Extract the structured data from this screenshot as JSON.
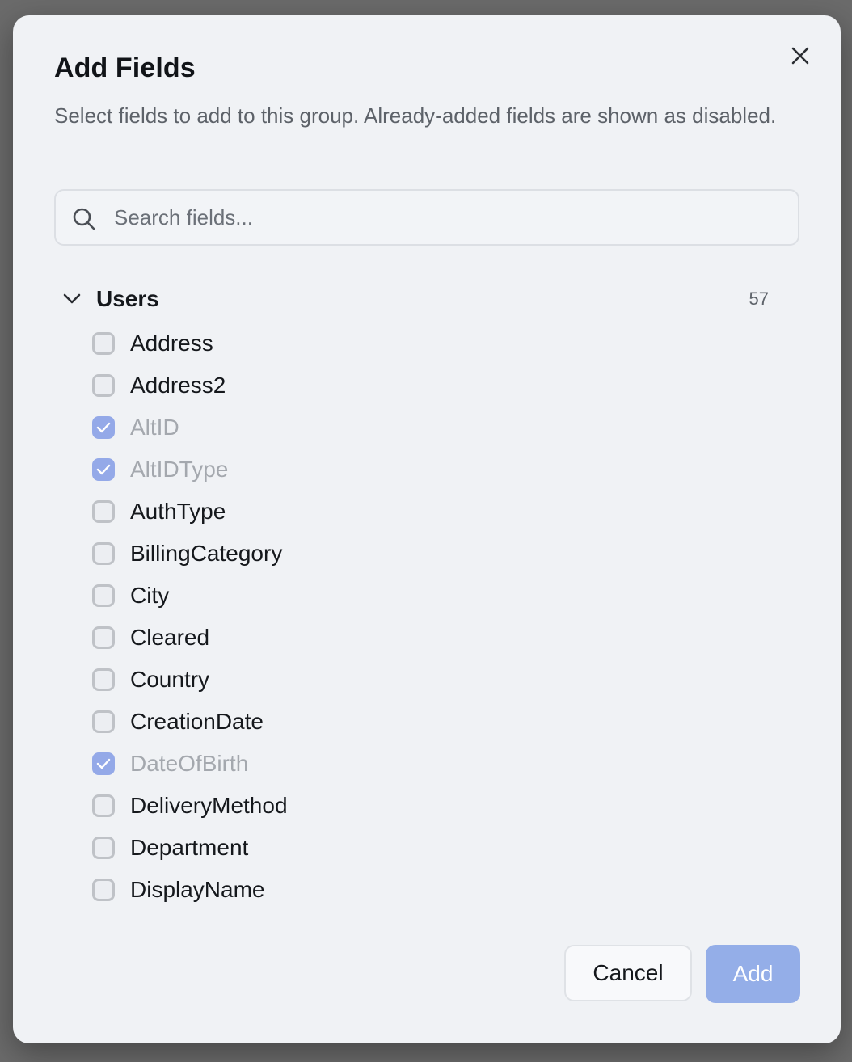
{
  "dialog": {
    "title": "Add Fields",
    "subtitle": "Select fields to add to this group. Already-added fields are shown as disabled.",
    "close_icon": "close-icon"
  },
  "search": {
    "placeholder": "Search fields...",
    "value": "",
    "icon": "search-icon"
  },
  "group": {
    "name": "Users",
    "count": "57",
    "expanded": true,
    "icon": "chevron-down-icon",
    "fields": [
      {
        "label": "Address",
        "checked": false,
        "disabled": false
      },
      {
        "label": "Address2",
        "checked": false,
        "disabled": false
      },
      {
        "label": "AltID",
        "checked": true,
        "disabled": true
      },
      {
        "label": "AltIDType",
        "checked": true,
        "disabled": true
      },
      {
        "label": "AuthType",
        "checked": false,
        "disabled": false
      },
      {
        "label": "BillingCategory",
        "checked": false,
        "disabled": false
      },
      {
        "label": "City",
        "checked": false,
        "disabled": false
      },
      {
        "label": "Cleared",
        "checked": false,
        "disabled": false
      },
      {
        "label": "Country",
        "checked": false,
        "disabled": false
      },
      {
        "label": "CreationDate",
        "checked": false,
        "disabled": false
      },
      {
        "label": "DateOfBirth",
        "checked": true,
        "disabled": true
      },
      {
        "label": "DeliveryMethod",
        "checked": false,
        "disabled": false
      },
      {
        "label": "Department",
        "checked": false,
        "disabled": false
      },
      {
        "label": "DisplayName",
        "checked": false,
        "disabled": false
      }
    ]
  },
  "footer": {
    "cancel_label": "Cancel",
    "add_label": "Add",
    "add_disabled": true
  },
  "colors": {
    "accent": "#94a9e8",
    "backdrop": "#6b6b6b",
    "dialog_bg": "#f0f2f5"
  }
}
